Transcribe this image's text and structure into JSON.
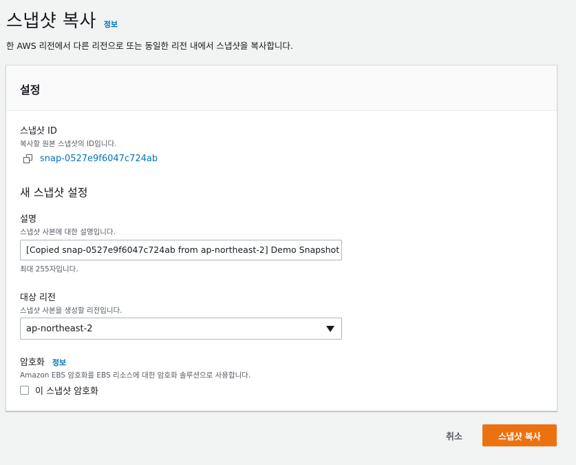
{
  "page": {
    "title": "스냅샷 복사",
    "info_label": "정보",
    "description": "한 AWS 리전에서 다른 리전으로 또는 동일한 리전 내에서 스냅샷을 복사합니다."
  },
  "panel": {
    "title": "설정",
    "snapshot_id": {
      "label": "스냅샷 ID",
      "description": "복사할 원본 스냅샷의 ID입니다.",
      "value": "snap-0527e9f6047c724ab",
      "icon": "copy-icon"
    },
    "new_snapshot_section": "새 스냅샷 설정",
    "description_field": {
      "label": "설명",
      "description": "스냅샷 사본에 대한 설명입니다.",
      "value": "[Copied snap-0527e9f6047c724ab from ap-northeast-2] Demo Snapshot",
      "constraint": "최대 255자입니다."
    },
    "region_field": {
      "label": "대상 리전",
      "description": "스냅샷 사본을 생성할 리전입니다.",
      "selected": "ap-northeast-2",
      "icon": "caret-down-icon"
    },
    "encryption": {
      "label": "암호화",
      "info_label": "정보",
      "description": "Amazon EBS 암호화를 EBS 리소스에 대한 암호화 솔루션으로 사용합니다.",
      "checkbox_label": "이 스냅샷 암호화",
      "checked": false
    }
  },
  "actions": {
    "cancel": "취소",
    "submit": "스냅샷 복사"
  },
  "colors": {
    "accent": "#ec7211",
    "link": "#0073bb",
    "background": "#f2f3f3"
  }
}
